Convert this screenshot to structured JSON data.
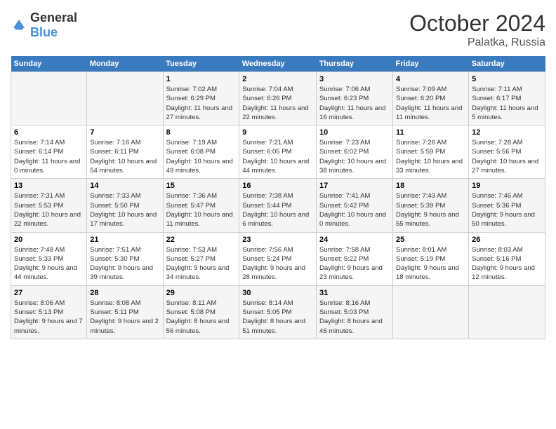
{
  "logo": {
    "general": "General",
    "blue": "Blue"
  },
  "title": "October 2024",
  "subtitle": "Palatka, Russia",
  "days_header": [
    "Sunday",
    "Monday",
    "Tuesday",
    "Wednesday",
    "Thursday",
    "Friday",
    "Saturday"
  ],
  "weeks": [
    [
      {
        "day": "",
        "sunrise": "",
        "sunset": "",
        "daylight": ""
      },
      {
        "day": "",
        "sunrise": "",
        "sunset": "",
        "daylight": ""
      },
      {
        "day": "1",
        "sunrise": "Sunrise: 7:02 AM",
        "sunset": "Sunset: 6:29 PM",
        "daylight": "Daylight: 11 hours and 27 minutes."
      },
      {
        "day": "2",
        "sunrise": "Sunrise: 7:04 AM",
        "sunset": "Sunset: 6:26 PM",
        "daylight": "Daylight: 11 hours and 22 minutes."
      },
      {
        "day": "3",
        "sunrise": "Sunrise: 7:06 AM",
        "sunset": "Sunset: 6:23 PM",
        "daylight": "Daylight: 11 hours and 16 minutes."
      },
      {
        "day": "4",
        "sunrise": "Sunrise: 7:09 AM",
        "sunset": "Sunset: 6:20 PM",
        "daylight": "Daylight: 11 hours and 11 minutes."
      },
      {
        "day": "5",
        "sunrise": "Sunrise: 7:11 AM",
        "sunset": "Sunset: 6:17 PM",
        "daylight": "Daylight: 11 hours and 5 minutes."
      }
    ],
    [
      {
        "day": "6",
        "sunrise": "Sunrise: 7:14 AM",
        "sunset": "Sunset: 6:14 PM",
        "daylight": "Daylight: 11 hours and 0 minutes."
      },
      {
        "day": "7",
        "sunrise": "Sunrise: 7:16 AM",
        "sunset": "Sunset: 6:11 PM",
        "daylight": "Daylight: 10 hours and 54 minutes."
      },
      {
        "day": "8",
        "sunrise": "Sunrise: 7:19 AM",
        "sunset": "Sunset: 6:08 PM",
        "daylight": "Daylight: 10 hours and 49 minutes."
      },
      {
        "day": "9",
        "sunrise": "Sunrise: 7:21 AM",
        "sunset": "Sunset: 6:05 PM",
        "daylight": "Daylight: 10 hours and 44 minutes."
      },
      {
        "day": "10",
        "sunrise": "Sunrise: 7:23 AM",
        "sunset": "Sunset: 6:02 PM",
        "daylight": "Daylight: 10 hours and 38 minutes."
      },
      {
        "day": "11",
        "sunrise": "Sunrise: 7:26 AM",
        "sunset": "Sunset: 5:59 PM",
        "daylight": "Daylight: 10 hours and 33 minutes."
      },
      {
        "day": "12",
        "sunrise": "Sunrise: 7:28 AM",
        "sunset": "Sunset: 5:56 PM",
        "daylight": "Daylight: 10 hours and 27 minutes."
      }
    ],
    [
      {
        "day": "13",
        "sunrise": "Sunrise: 7:31 AM",
        "sunset": "Sunset: 5:53 PM",
        "daylight": "Daylight: 10 hours and 22 minutes."
      },
      {
        "day": "14",
        "sunrise": "Sunrise: 7:33 AM",
        "sunset": "Sunset: 5:50 PM",
        "daylight": "Daylight: 10 hours and 17 minutes."
      },
      {
        "day": "15",
        "sunrise": "Sunrise: 7:36 AM",
        "sunset": "Sunset: 5:47 PM",
        "daylight": "Daylight: 10 hours and 11 minutes."
      },
      {
        "day": "16",
        "sunrise": "Sunrise: 7:38 AM",
        "sunset": "Sunset: 5:44 PM",
        "daylight": "Daylight: 10 hours and 6 minutes."
      },
      {
        "day": "17",
        "sunrise": "Sunrise: 7:41 AM",
        "sunset": "Sunset: 5:42 PM",
        "daylight": "Daylight: 10 hours and 0 minutes."
      },
      {
        "day": "18",
        "sunrise": "Sunrise: 7:43 AM",
        "sunset": "Sunset: 5:39 PM",
        "daylight": "Daylight: 9 hours and 55 minutes."
      },
      {
        "day": "19",
        "sunrise": "Sunrise: 7:46 AM",
        "sunset": "Sunset: 5:36 PM",
        "daylight": "Daylight: 9 hours and 50 minutes."
      }
    ],
    [
      {
        "day": "20",
        "sunrise": "Sunrise: 7:48 AM",
        "sunset": "Sunset: 5:33 PM",
        "daylight": "Daylight: 9 hours and 44 minutes."
      },
      {
        "day": "21",
        "sunrise": "Sunrise: 7:51 AM",
        "sunset": "Sunset: 5:30 PM",
        "daylight": "Daylight: 9 hours and 39 minutes."
      },
      {
        "day": "22",
        "sunrise": "Sunrise: 7:53 AM",
        "sunset": "Sunset: 5:27 PM",
        "daylight": "Daylight: 9 hours and 34 minutes."
      },
      {
        "day": "23",
        "sunrise": "Sunrise: 7:56 AM",
        "sunset": "Sunset: 5:24 PM",
        "daylight": "Daylight: 9 hours and 28 minutes."
      },
      {
        "day": "24",
        "sunrise": "Sunrise: 7:58 AM",
        "sunset": "Sunset: 5:22 PM",
        "daylight": "Daylight: 9 hours and 23 minutes."
      },
      {
        "day": "25",
        "sunrise": "Sunrise: 8:01 AM",
        "sunset": "Sunset: 5:19 PM",
        "daylight": "Daylight: 9 hours and 18 minutes."
      },
      {
        "day": "26",
        "sunrise": "Sunrise: 8:03 AM",
        "sunset": "Sunset: 5:16 PM",
        "daylight": "Daylight: 9 hours and 12 minutes."
      }
    ],
    [
      {
        "day": "27",
        "sunrise": "Sunrise: 8:06 AM",
        "sunset": "Sunset: 5:13 PM",
        "daylight": "Daylight: 9 hours and 7 minutes."
      },
      {
        "day": "28",
        "sunrise": "Sunrise: 8:08 AM",
        "sunset": "Sunset: 5:11 PM",
        "daylight": "Daylight: 9 hours and 2 minutes."
      },
      {
        "day": "29",
        "sunrise": "Sunrise: 8:11 AM",
        "sunset": "Sunset: 5:08 PM",
        "daylight": "Daylight: 8 hours and 56 minutes."
      },
      {
        "day": "30",
        "sunrise": "Sunrise: 8:14 AM",
        "sunset": "Sunset: 5:05 PM",
        "daylight": "Daylight: 8 hours and 51 minutes."
      },
      {
        "day": "31",
        "sunrise": "Sunrise: 8:16 AM",
        "sunset": "Sunset: 5:03 PM",
        "daylight": "Daylight: 8 hours and 46 minutes."
      },
      {
        "day": "",
        "sunrise": "",
        "sunset": "",
        "daylight": ""
      },
      {
        "day": "",
        "sunrise": "",
        "sunset": "",
        "daylight": ""
      }
    ]
  ]
}
